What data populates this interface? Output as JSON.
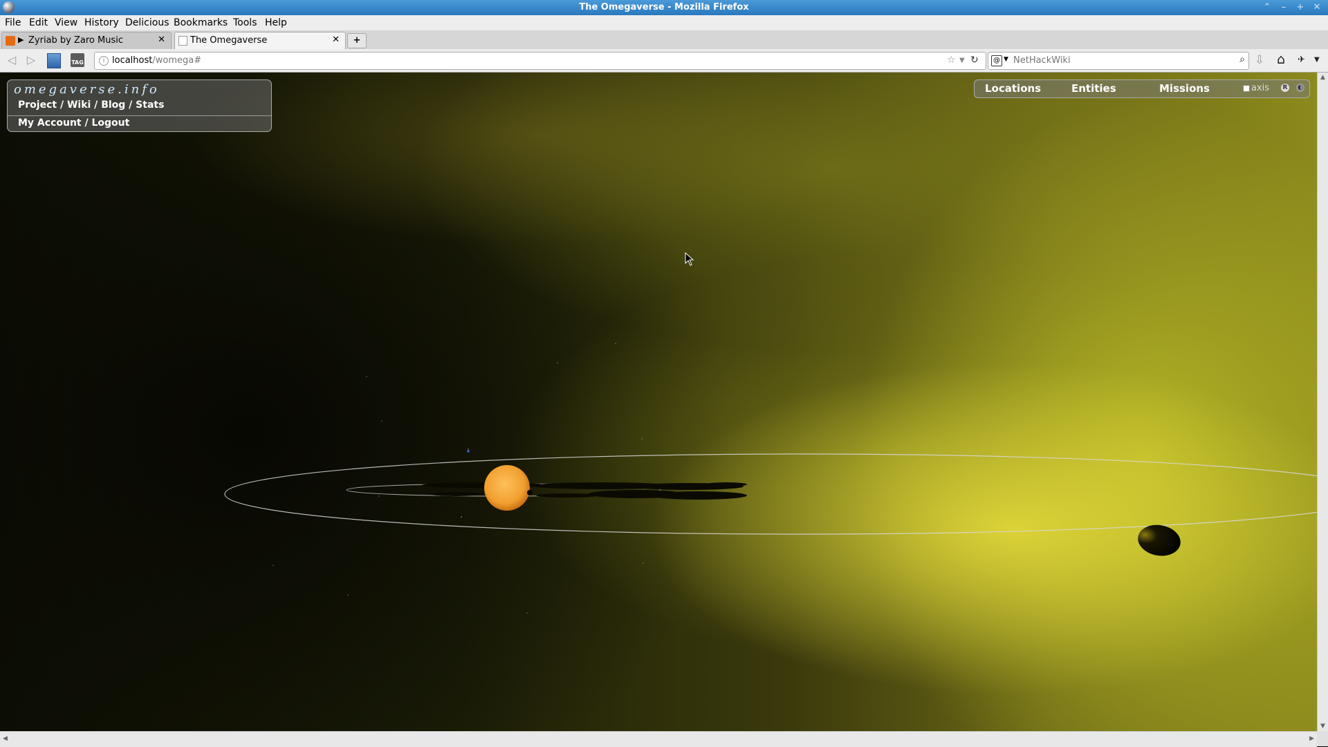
{
  "window": {
    "title": "The Omegaverse - Mozilla Firefox"
  },
  "menubar": {
    "items": [
      "File",
      "Edit",
      "View",
      "History",
      "Delicious",
      "Bookmarks",
      "Tools",
      "Help"
    ]
  },
  "tabs": [
    {
      "label": "Zyriab by Zaro Music",
      "playing_indicator": "▶",
      "active": false
    },
    {
      "label": "The Omegaverse",
      "active": true
    }
  ],
  "newtab_label": "+",
  "toolbar": {
    "url_host": "localhost",
    "url_path": "/womega#",
    "search_placeholder": "NetHackWiki",
    "search_engine_icon": "at-sign-icon"
  },
  "site_panel": {
    "logo": "omegaverse.info",
    "links_row1": [
      "Project",
      "Wiki",
      "Blog",
      "Stats"
    ],
    "links_row2": [
      "My Account",
      "Logout"
    ],
    "separator": " / "
  },
  "right_menu": {
    "items": [
      "Locations",
      "Entities",
      "Missions"
    ],
    "axis_label": "axis",
    "axis_checked": false,
    "icons": [
      "registered-icon",
      "settings-toggle-icon"
    ]
  },
  "scene": {
    "colors": {
      "star": "#f0a030",
      "nebula": "#c8c63a",
      "orbit": "#d8d8d8",
      "planet": "#0a0a02"
    }
  }
}
